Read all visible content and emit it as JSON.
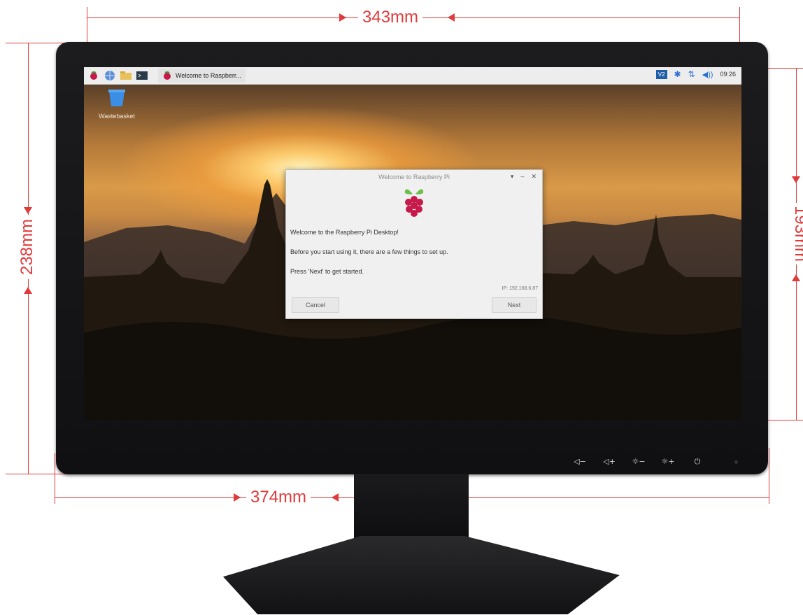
{
  "dimensions": {
    "top_width": "343mm",
    "bottom_width": "374mm",
    "left_height": "238mm",
    "right_height": "193mm"
  },
  "taskbar": {
    "icons": [
      "raspberry-menu-icon",
      "globe-icon",
      "folder-icon",
      "terminal-icon"
    ],
    "task_label": "Welcome to Raspberr...",
    "status_icons": [
      "vnc-icon",
      "bluetooth-icon",
      "network-icon",
      "volume-icon"
    ],
    "vnc_label": "V2",
    "clock": "09:26"
  },
  "desktop": {
    "wastebasket_label": "Wastebasket"
  },
  "dialog": {
    "title": "Welcome to Raspberry Pi",
    "line1": "Welcome to the Raspberry Pi Desktop!",
    "line2": "Before you start using it, there are a few things to set up.",
    "line3": "Press 'Next' to get started.",
    "ip": "IP: 192.168.6.87",
    "cancel_label": "Cancel",
    "next_label": "Next"
  },
  "bezel_buttons": [
    "◁−",
    "◁+",
    "☼−",
    "☼+",
    "⏻"
  ],
  "colors": {
    "dimension": "#e03a3a",
    "bezel": "#141416",
    "dialog_bg": "#f0f0f0"
  }
}
